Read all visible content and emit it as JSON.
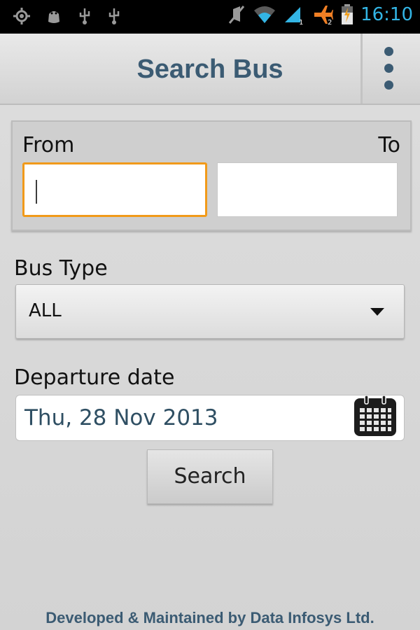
{
  "status_bar": {
    "time": "16:10",
    "icons": [
      "gps-icon",
      "android-debug-icon",
      "usb-icon",
      "usb-icon",
      "mute-icon",
      "wifi-icon",
      "signal-icon",
      "airplane-icon",
      "battery-charging-icon"
    ],
    "sim_labels": [
      "1",
      "2"
    ]
  },
  "action_bar": {
    "title": "Search Bus",
    "overflow_icon": "overflow-menu-icon"
  },
  "route": {
    "from_label": "From",
    "to_label": "To",
    "from_value": "",
    "to_value": ""
  },
  "bus_type": {
    "label": "Bus Type",
    "selected": "ALL"
  },
  "departure": {
    "label": "Departure date",
    "value": "Thu, 28 Nov 2013",
    "icon": "calendar-icon"
  },
  "search_button": "Search",
  "footer": "Developed & Maintained by Data Infosys Ltd.",
  "colors": {
    "accent_text": "#3b5b73",
    "focus_border": "#f19a1a",
    "status_text": "#33b5e5"
  }
}
